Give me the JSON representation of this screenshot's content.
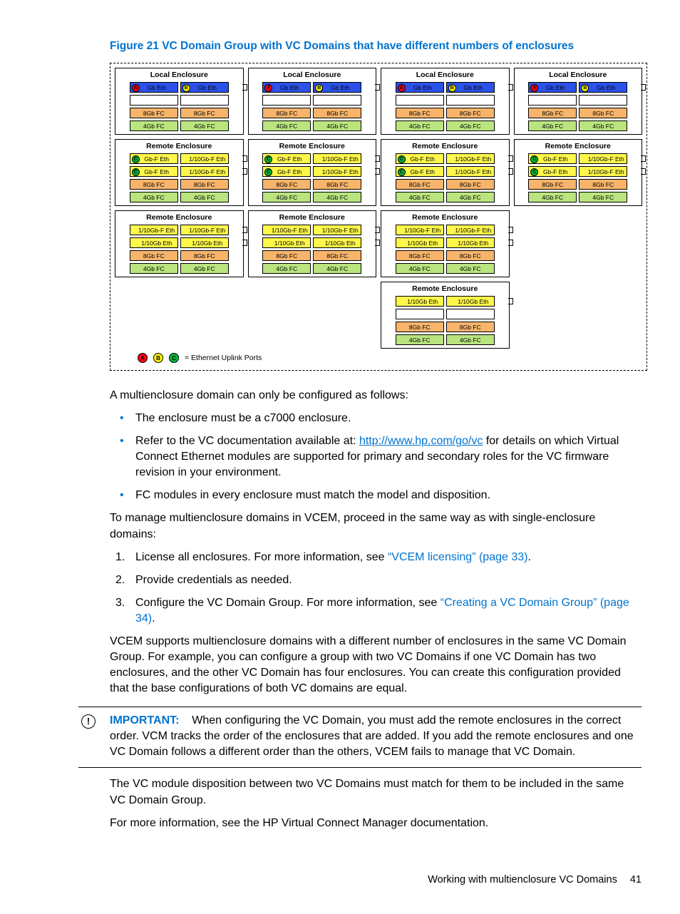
{
  "figure": {
    "caption": "Figure 21 VC Domain Group with VC Domains that have different numbers of enclosures",
    "labels": {
      "local": "Local Enclosure",
      "remote": "Remote Enclosure",
      "ethA": "Gb Eth",
      "ethB": "Gb Eth",
      "gbf_l": "Gb-F Eth",
      "gbf_r": "1/10Gb-F Eth",
      "teng": "1/10Gb Eth",
      "fc8": "8Gb FC",
      "fc4": "4Gb FC",
      "fc8o": "8Gb FC",
      "fc4o": "4Gb FC"
    },
    "legend": "= Ethernet Uplink Ports",
    "ports": {
      "a": "A",
      "b": "B",
      "c": "C"
    }
  },
  "text": {
    "intro": "A multienclosure domain can only be configured as follows:",
    "b1": "The enclosure must be a c7000 enclosure.",
    "b2a": "Refer to the VC documentation available at: ",
    "b2link": "http://www.hp.com/go/vc",
    "b2b": " for details on which Virtual Connect Ethernet modules are supported for primary and secondary roles for the VC firmware revision in your environment.",
    "b3": "FC modules in every enclosure must match the model and disposition.",
    "p2": "To manage multienclosure domains in VCEM, proceed in the same way as with single-enclosure domains:",
    "n1a": "License all enclosures. For more information, see ",
    "n1link": "“VCEM licensing” (page 33)",
    "n1b": ".",
    "n2": "Provide credentials as needed.",
    "n3a": "Configure the VC Domain Group. For more information, see ",
    "n3link": "“Creating a VC Domain Group” (page 34)",
    "n3b": ".",
    "p3": "VCEM supports multienclosure domains with a different number of enclosures in the same VC Domain Group. For example, you can configure a group with two VC Domains if one VC Domain has two enclosures, and the other VC Domain has four enclosures. You can create this configuration provided that the base configurations of both VC domains are equal.",
    "imp_label": "IMPORTANT:",
    "imp_body": "When configuring the VC Domain, you must add the remote enclosures in the correct order. VCM tracks the order of the enclosures that are added. If you add the remote enclosures and one VC Domain follows a different order than the others, VCEM fails to manage that VC Domain.",
    "p4": "The VC module disposition between two VC Domains must match for them to be included in the same VC Domain Group.",
    "p5": "For more information, see the HP Virtual Connect Manager documentation."
  },
  "footer": {
    "section": "Working with multienclosure VC Domains",
    "page": "41"
  }
}
